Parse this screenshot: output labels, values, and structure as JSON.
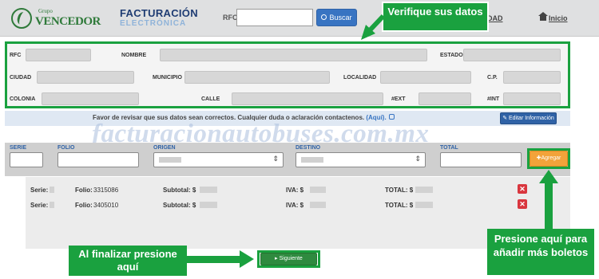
{
  "header": {
    "brand": {
      "grupo": "Grupo",
      "name": "VENCEDOR"
    },
    "title_line1": "FACTURACIÓN",
    "title_line2": "ELECTRÓNICA",
    "rfc_label": "RFC",
    "search_button": "Buscar",
    "nav_item_partial": "DAD",
    "nav_home": "Inicio"
  },
  "callouts": {
    "verify": "Verifique sus datos",
    "finish": "Al finalizar presione aquí",
    "add_more": "Presione aquí para añadir más boletos"
  },
  "personal_data": {
    "labels": {
      "rfc": "RFC",
      "nombre": "NOMBRE",
      "estado": "ESTADO",
      "ciudad": "CIUDAD",
      "municipio": "MUNICIPIO",
      "localidad": "LOCALIDAD",
      "cp": "C.P.",
      "colonia": "COLONIA",
      "calle": "CALLE",
      "ext": "#EXT",
      "int": "#INT"
    }
  },
  "notice": {
    "text": "Favor de revisar que sus datos sean correctos. Cualquier duda o aclaración contactenos.",
    "link": "(Aquí).",
    "edit_button": "Editar Información"
  },
  "watermark": "facturacionautobuses.com.mx",
  "ticket_form": {
    "labels": {
      "serie": "SERIE",
      "folio": "FOLIO",
      "origen": "ORIGEN",
      "destino": "DESTINO",
      "total": "TOTAL"
    },
    "add_button": "Agregar"
  },
  "tickets": {
    "labels": {
      "serie": "Serie:",
      "folio": "Folio:",
      "subtotal": "Subtotal: $",
      "iva": "IVA: $",
      "total": "TOTAL: $"
    },
    "rows": [
      {
        "folio": "3315086"
      },
      {
        "folio": "3405010"
      }
    ]
  },
  "next_button": "Siguiente",
  "colors": {
    "callout_green": "#1aa13f",
    "primary_blue": "#3874c2",
    "add_orange": "#f2a33a",
    "delete_red": "#d9363e"
  }
}
